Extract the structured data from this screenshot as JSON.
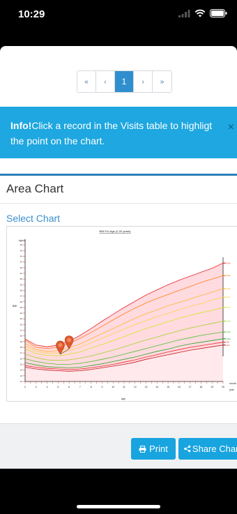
{
  "status_bar": {
    "time": "10:29"
  },
  "pager": {
    "first": "«",
    "prev": "‹",
    "current": "1",
    "next": "›",
    "last": "»"
  },
  "info": {
    "label": "Info!",
    "text": "Click a record in the Visits table to highligt the point on the chart.",
    "close": "×"
  },
  "panel": {
    "title": "Area Chart",
    "select_chart": "Select Chart"
  },
  "chart": {
    "title": "BMI For Age (2-20 years)",
    "y_unit": "kg/m2",
    "y_axis_label": "BMI",
    "x_axis_label": "Age",
    "right_labels": [
      "month",
      "year"
    ],
    "percentile_labels": [
      "97th",
      "95th",
      "90th",
      "85th",
      "75th",
      "50th",
      "25th",
      "10th",
      "5th",
      "3rd"
    ],
    "percentile_colors": [
      "#e8262a",
      "#ff7f16",
      "#ffb530",
      "#ffd24a",
      "#d4e61e",
      "#9ed42a",
      "#4cbf2e",
      "#2c9f2a",
      "#e8262a",
      "#c21a1f"
    ]
  },
  "chart_data": {
    "type": "area",
    "title": "BMI For Age (2-20 years)",
    "xlabel": "Age",
    "ylabel": "BMI",
    "x": [
      2,
      3,
      4,
      5,
      6,
      7,
      8,
      9,
      10,
      11,
      12,
      13,
      14,
      15,
      16,
      17,
      18,
      19,
      20
    ],
    "ylim": [
      12,
      37
    ],
    "y_ticks": [
      12,
      13,
      14,
      15,
      16,
      17,
      18,
      19,
      20,
      21,
      22,
      23,
      24,
      25,
      26,
      27,
      28,
      29,
      30,
      31,
      32,
      33,
      34,
      35,
      36
    ],
    "series": [
      {
        "name": "97th",
        "values": [
          19.5,
          18.4,
          18.1,
          18.4,
          19.1,
          20.1,
          21.3,
          22.6,
          23.8,
          25.0,
          26.1,
          27.2,
          28.1,
          29.0,
          29.8,
          30.5,
          31.2,
          31.9,
          32.8
        ]
      },
      {
        "name": "95th",
        "values": [
          19.3,
          18.0,
          17.8,
          18.0,
          18.7,
          19.6,
          20.6,
          21.7,
          22.8,
          23.9,
          24.9,
          25.8,
          26.6,
          27.3,
          28.0,
          28.7,
          29.4,
          30.0,
          30.6
        ]
      },
      {
        "name": "90th",
        "values": [
          18.7,
          17.6,
          17.3,
          17.4,
          17.9,
          18.6,
          19.5,
          20.4,
          21.3,
          22.2,
          23.1,
          23.9,
          24.6,
          25.3,
          25.9,
          26.5,
          27.1,
          27.7,
          28.3
        ]
      },
      {
        "name": "85th",
        "values": [
          18.3,
          17.3,
          17.0,
          17.0,
          17.4,
          18.0,
          18.8,
          19.6,
          20.4,
          21.2,
          22.0,
          22.7,
          23.4,
          24.0,
          24.6,
          25.2,
          25.7,
          26.3,
          26.8
        ]
      },
      {
        "name": "75th",
        "values": [
          17.8,
          16.9,
          16.6,
          16.5,
          16.8,
          17.2,
          17.9,
          18.5,
          19.2,
          19.9,
          20.6,
          21.3,
          21.9,
          22.5,
          23.1,
          23.6,
          24.1,
          24.5,
          25.0
        ]
      },
      {
        "name": "50th",
        "values": [
          16.8,
          16.2,
          15.8,
          15.7,
          15.8,
          16.1,
          16.5,
          17.0,
          17.5,
          18.1,
          18.7,
          19.3,
          19.8,
          20.4,
          20.9,
          21.4,
          21.8,
          22.2,
          22.6
        ]
      },
      {
        "name": "25th",
        "values": [
          16.0,
          15.5,
          15.2,
          15.0,
          15.0,
          15.2,
          15.5,
          15.9,
          16.3,
          16.8,
          17.3,
          17.8,
          18.3,
          18.8,
          19.3,
          19.7,
          20.1,
          20.4,
          20.7
        ]
      },
      {
        "name": "10th",
        "values": [
          15.3,
          14.9,
          14.6,
          14.5,
          14.4,
          14.5,
          14.8,
          15.1,
          15.5,
          15.9,
          16.3,
          16.8,
          17.3,
          17.7,
          18.2,
          18.6,
          18.9,
          19.2,
          19.5
        ]
      },
      {
        "name": "5th",
        "values": [
          14.8,
          14.5,
          14.3,
          14.2,
          14.1,
          14.2,
          14.4,
          14.7,
          15.0,
          15.4,
          15.8,
          16.3,
          16.7,
          17.2,
          17.6,
          18.0,
          18.3,
          18.6,
          18.9
        ]
      },
      {
        "name": "3rd",
        "values": [
          14.5,
          14.2,
          14.0,
          13.9,
          13.8,
          13.9,
          14.1,
          14.4,
          14.7,
          15.0,
          15.4,
          15.9,
          16.3,
          16.7,
          17.1,
          17.5,
          17.8,
          18.1,
          18.4
        ]
      }
    ],
    "markers": [
      {
        "x": 5.2,
        "y": 16.8
      },
      {
        "x": 6.0,
        "y": 17.7
      }
    ]
  },
  "buttons": {
    "print": "Print",
    "share": "Share Chart"
  }
}
